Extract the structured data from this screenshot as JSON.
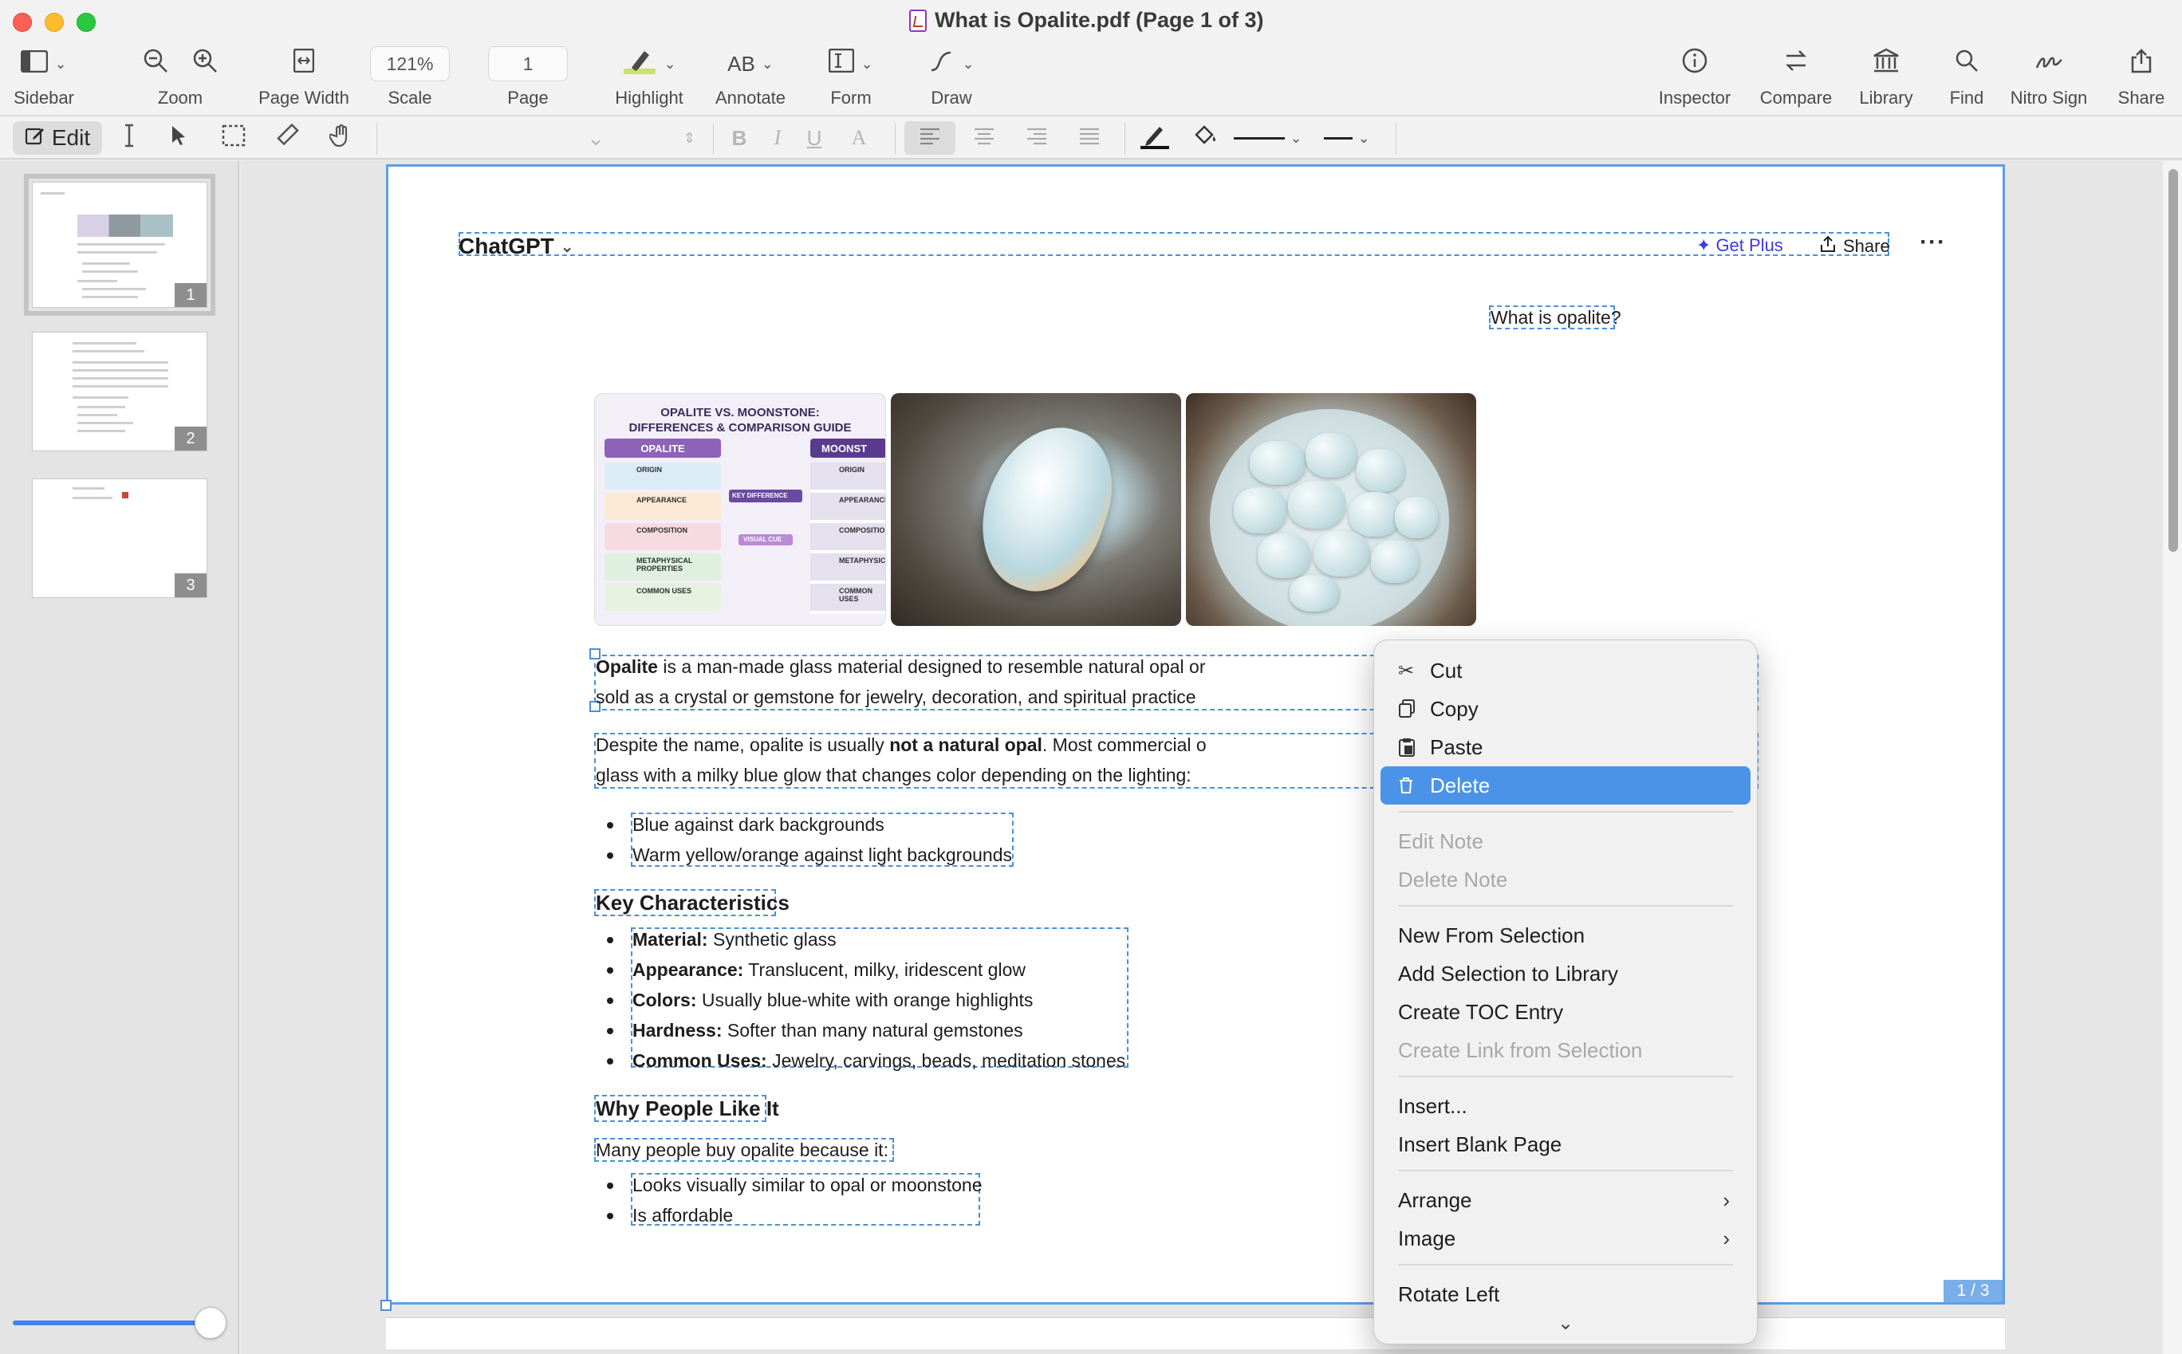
{
  "window": {
    "title": "What is Opalite.pdf (Page 1 of 3)"
  },
  "toolbar": {
    "sidebar": "Sidebar",
    "zoom": "Zoom",
    "page_width": "Page Width",
    "scale": "Scale",
    "scale_value": "121%",
    "page": "Page",
    "page_value": "1",
    "highlight": "Highlight",
    "annotate": "Annotate",
    "annotate_glyph": "AB",
    "form": "Form",
    "draw": "Draw",
    "inspector": "Inspector",
    "compare": "Compare",
    "library": "Library",
    "find": "Find",
    "nitro_sign": "Nitro Sign",
    "share": "Share"
  },
  "edit_bar": {
    "edit_label": "Edit",
    "bold": "B",
    "italic": "I",
    "underline": "U",
    "font_glyph": "A"
  },
  "thumbnails": [
    {
      "num": "1"
    },
    {
      "num": "2"
    },
    {
      "num": "3"
    }
  ],
  "document": {
    "header": {
      "app": "ChatGPT",
      "get_plus": "Get Plus",
      "share": "Share",
      "more": "···"
    },
    "question": "What is opalite?",
    "guide": {
      "title_line1": "OPALITE VS. MOONSTONE:",
      "title_line2": "DIFFERENCES & COMPARISON GUIDE",
      "col1": "OPALITE",
      "col2": "MOONST",
      "rows": [
        "ORIGIN",
        "APPEARANCE",
        "COMPOSITION",
        "METAPHYSICAL PROPERTIES",
        "COMMON USES"
      ],
      "rows_right": [
        "ORIGIN",
        "APPEARANCE",
        "COMPOSITION",
        "METAPHYSICAL",
        "COMMON USES"
      ],
      "key_difference": "KEY DIFFERENCE",
      "visual_cue": "VISUAL CUE"
    },
    "p1": {
      "bold": "Opalite",
      "line1": " is a man-made glass material designed to resemble natural opal or",
      "line2": "sold as a crystal or gemstone for jewelry, decoration, and spiritual practice"
    },
    "p2": {
      "pre": "Despite the name, opalite is usually ",
      "bold": "not a natural opal",
      "post": ". Most commercial o",
      "line2": "glass with a milky blue glow that changes color depending on the lighting:"
    },
    "bullets1": [
      "Blue against dark backgrounds",
      "Warm yellow/orange against light backgrounds"
    ],
    "h_key": "Key Characteristics",
    "characteristics": [
      {
        "label": "Material:",
        "value": " Synthetic glass"
      },
      {
        "label": "Appearance:",
        "value": " Translucent, milky, iridescent glow"
      },
      {
        "label": "Colors:",
        "value": " Usually blue-white with orange highlights"
      },
      {
        "label": "Hardness:",
        "value": " Softer than many natural gemstones"
      },
      {
        "label": "Common Uses:",
        "value": " Jewelry, carvings, beads, meditation stones"
      }
    ],
    "h_why": "Why People Like It",
    "why_intro": "Many people buy opalite because it:",
    "bullets2": [
      "Looks visually similar to opal or moonstone",
      "Is affordable"
    ],
    "page_counter": "1 / 3"
  },
  "context_menu": {
    "cut": "Cut",
    "copy": "Copy",
    "paste": "Paste",
    "delete": "Delete",
    "edit_note": "Edit Note",
    "delete_note": "Delete Note",
    "new_from_selection": "New From Selection",
    "add_selection_to_library": "Add Selection to Library",
    "create_toc_entry": "Create TOC Entry",
    "create_link_from_selection": "Create Link from Selection",
    "insert": "Insert...",
    "insert_blank_page": "Insert Blank Page",
    "arrange": "Arrange",
    "image": "Image",
    "rotate_left": "Rotate Left"
  },
  "colors": {
    "accent": "#4b93e8",
    "selection": "#4a90d9",
    "get_plus": "#3b3bdb"
  }
}
